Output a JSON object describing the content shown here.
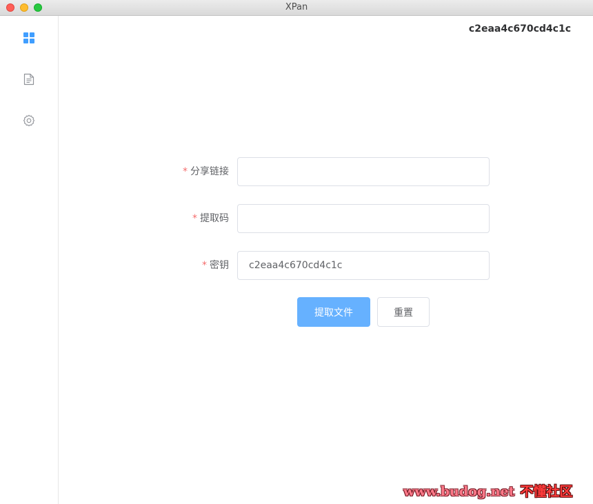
{
  "window": {
    "title": "XPan"
  },
  "sidebar": {
    "items": [
      {
        "icon": "apps-grid-icon",
        "active": true
      },
      {
        "icon": "document-icon",
        "active": false
      },
      {
        "icon": "gear-icon",
        "active": false
      }
    ]
  },
  "header": {
    "user_key": "c2eaa4c670cd4c1c"
  },
  "form": {
    "required_mark": "*",
    "fields": [
      {
        "label": "分享链接",
        "value": "",
        "placeholder": ""
      },
      {
        "label": "提取码",
        "value": "",
        "placeholder": ""
      },
      {
        "label": "密钥",
        "value": "c2eaa4c670cd4c1c",
        "placeholder": ""
      }
    ],
    "submit_label": "提取文件",
    "reset_label": "重置"
  },
  "watermark": {
    "url": "www.budog.net",
    "name": "不懂社区"
  },
  "colors": {
    "primary": "#66b1ff",
    "required": "#f56c6c",
    "nav_active": "#409eff",
    "nav_inactive": "#909399"
  }
}
